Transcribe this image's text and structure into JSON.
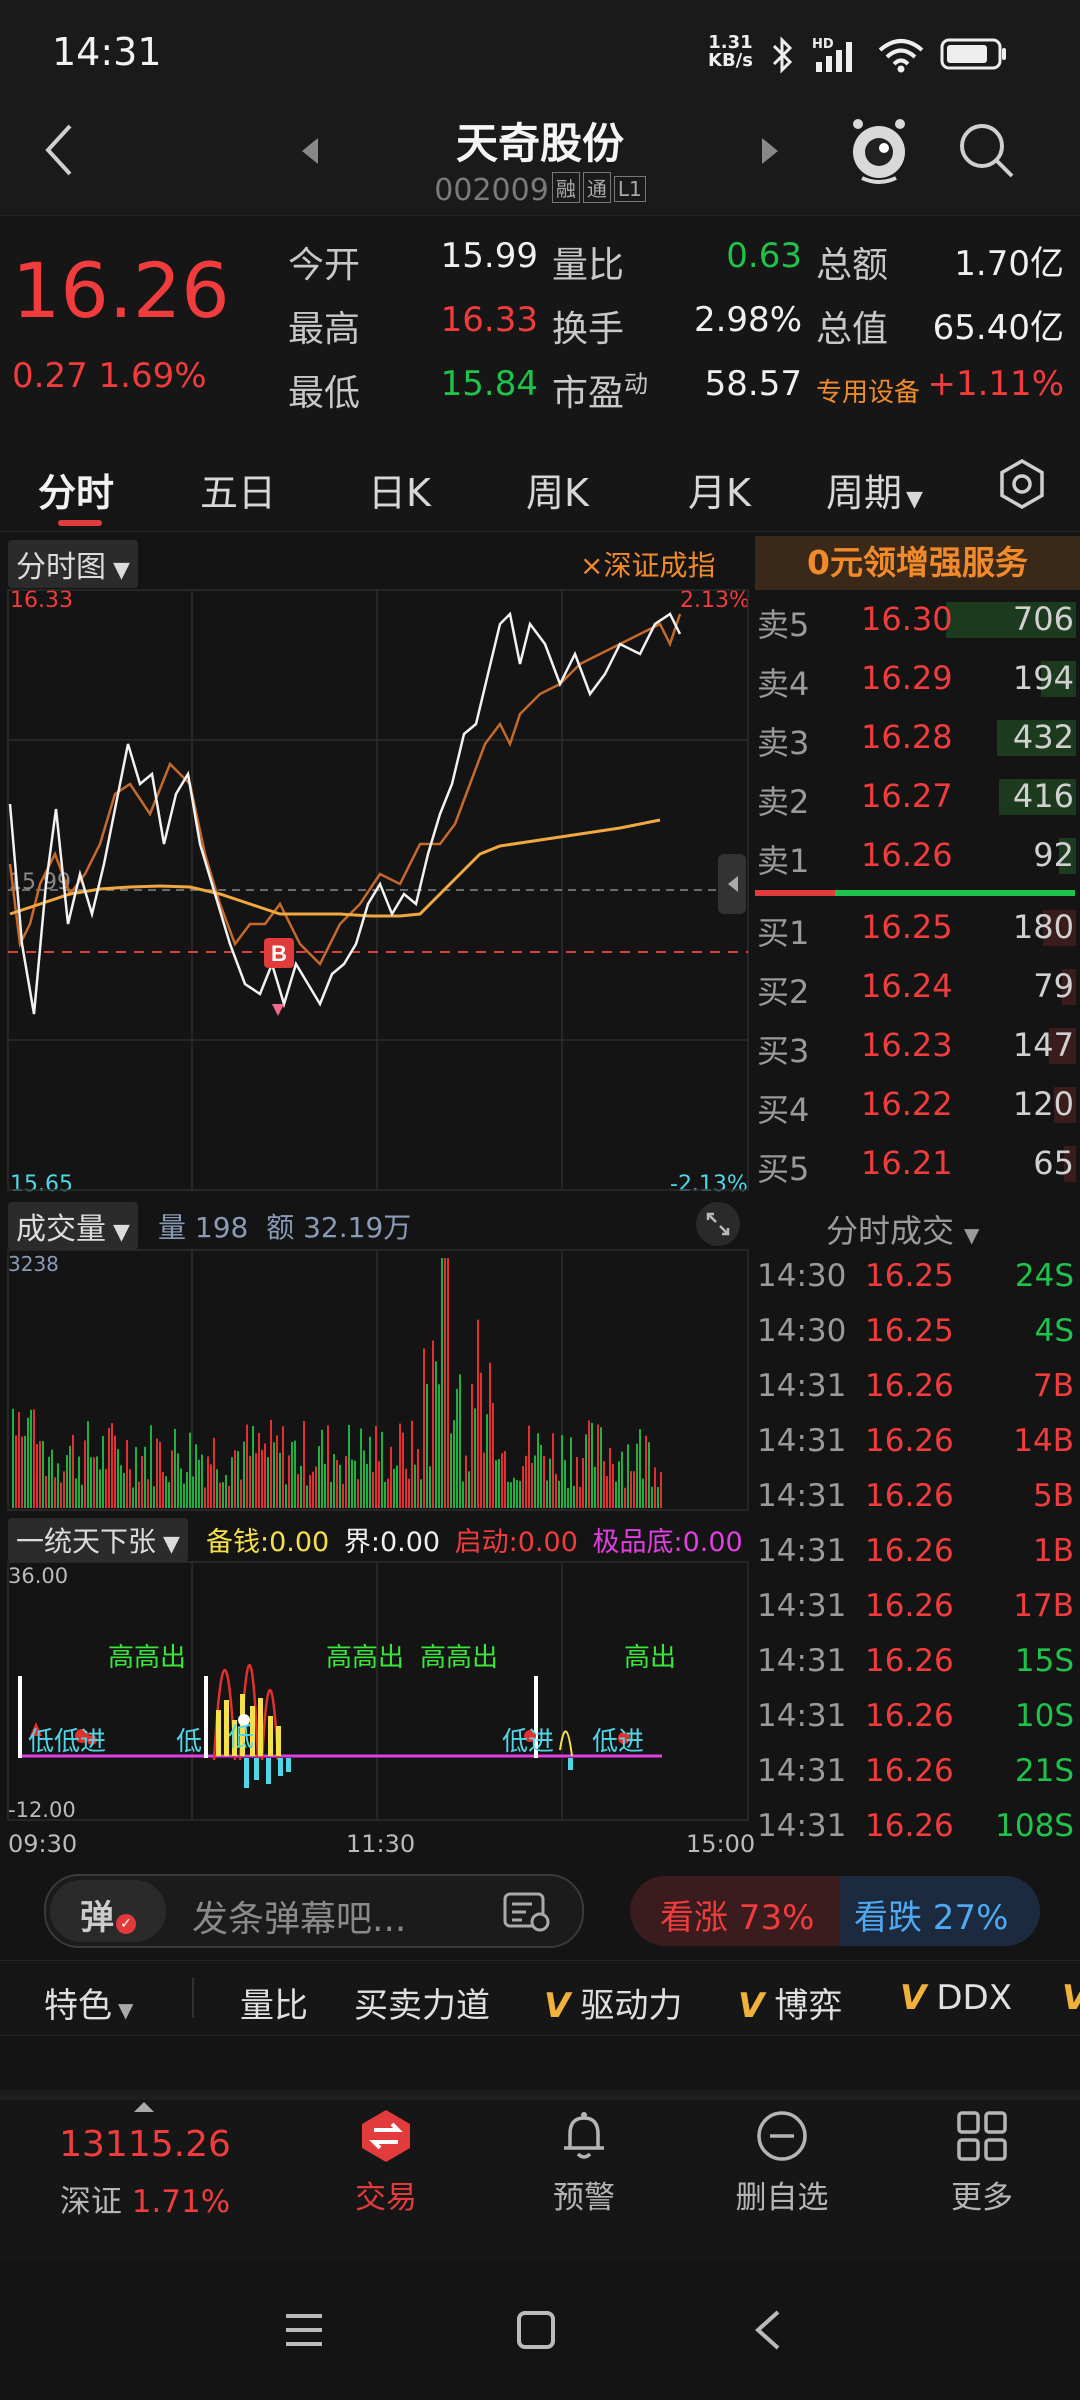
{
  "status_bar": {
    "time": "14:31",
    "net_speed_top": "1.31",
    "net_speed_bottom": "KB/s"
  },
  "header": {
    "stock_name": "天奇股份",
    "stock_code": "002009",
    "tags": [
      "融",
      "通",
      "L1"
    ]
  },
  "quote": {
    "price": "16.26",
    "change": "0.27",
    "change_pct": "1.69%",
    "rows": [
      [
        {
          "label": "今开",
          "value": "15.99"
        },
        {
          "label": "量比",
          "value": "0.63"
        },
        {
          "label": "总额",
          "value": "1.70亿"
        }
      ],
      [
        {
          "label": "最高",
          "value": "16.33"
        },
        {
          "label": "换手",
          "value": "2.98%"
        },
        {
          "label": "总值",
          "value": "65.40亿"
        }
      ],
      [
        {
          "label": "最低",
          "value": "15.84"
        },
        {
          "label": "市盈",
          "sup": "动",
          "value": "58.57"
        },
        {
          "label": "专用设备",
          "value": "+1.11%"
        }
      ]
    ]
  },
  "tabs": [
    "分时",
    "五日",
    "日K",
    "周K",
    "月K",
    "周期"
  ],
  "intraday": {
    "panel_label": "分时图",
    "compare_label": "×深证成指",
    "max_price": "16.33",
    "min_price": "15.65",
    "max_pct": "2.13%",
    "min_pct": "-2.13%",
    "ref_price": "15.99",
    "signal": "B",
    "promo": "0元领增强服务"
  },
  "volume": {
    "panel_label": "成交量",
    "vol_label": "量",
    "vol_value": "198",
    "amt_label": "额",
    "amt_value": "32.19万",
    "max": "3238"
  },
  "indicator": {
    "panel_label": "一统天下张",
    "items": [
      {
        "label": "备钱:",
        "value": "0.00",
        "color": "#f4e04a"
      },
      {
        "label": "界:",
        "value": "0.00",
        "color": "#f0f0f0"
      },
      {
        "label": "启动:",
        "value": "0.00",
        "color": "#f03c3c"
      },
      {
        "label": "极品底:",
        "value": "0.00",
        "color": "#e040e0"
      }
    ],
    "max": "36.00",
    "min": "-12.00",
    "texts_high": [
      "高出",
      "高高出",
      "高高出",
      "高高出",
      "高出"
    ],
    "texts_low": [
      "低低进",
      "低",
      "低",
      "低进",
      "低进"
    ]
  },
  "time_axis": [
    "09:30",
    "11:30",
    "15:00"
  ],
  "order_book": {
    "sell": [
      {
        "label": "卖5",
        "price": "16.30",
        "vol": "706",
        "bar": 1.0
      },
      {
        "label": "卖4",
        "price": "16.29",
        "vol": "194",
        "bar": 0.27
      },
      {
        "label": "卖3",
        "price": "16.28",
        "vol": "432",
        "bar": 0.61
      },
      {
        "label": "卖2",
        "price": "16.27",
        "vol": "416",
        "bar": 0.59
      },
      {
        "label": "卖1",
        "price": "16.26",
        "vol": "92",
        "bar": 0.13
      }
    ],
    "buy": [
      {
        "label": "买1",
        "price": "16.25",
        "vol": "180",
        "bar": 0.25
      },
      {
        "label": "买2",
        "price": "16.24",
        "vol": "79",
        "bar": 0.11
      },
      {
        "label": "买3",
        "price": "16.23",
        "vol": "147",
        "bar": 0.21
      },
      {
        "label": "买4",
        "price": "16.22",
        "vol": "120",
        "bar": 0.17
      },
      {
        "label": "买5",
        "price": "16.21",
        "vol": "65",
        "bar": 0.09
      }
    ]
  },
  "trades": {
    "title": "分时成交",
    "rows": [
      {
        "time": "14:30",
        "price": "16.25",
        "vol": "24S"
      },
      {
        "time": "14:30",
        "price": "16.25",
        "vol": "4S"
      },
      {
        "time": "14:31",
        "price": "16.26",
        "vol": "7B"
      },
      {
        "time": "14:31",
        "price": "16.26",
        "vol": "14B"
      },
      {
        "time": "14:31",
        "price": "16.26",
        "vol": "5B"
      },
      {
        "time": "14:31",
        "price": "16.26",
        "vol": "1B"
      },
      {
        "time": "14:31",
        "price": "16.26",
        "vol": "17B"
      },
      {
        "time": "14:31",
        "price": "16.26",
        "vol": "15S"
      },
      {
        "time": "14:31",
        "price": "16.26",
        "vol": "10S"
      },
      {
        "time": "14:31",
        "price": "16.26",
        "vol": "21S"
      },
      {
        "time": "14:31",
        "price": "16.26",
        "vol": "108S"
      }
    ]
  },
  "comment": {
    "toggle": "弹",
    "placeholder": "发条弹幕吧...",
    "bull": "看涨 73%",
    "bear": "看跌 27%",
    "bull_pct": 73
  },
  "features": {
    "first": "特色",
    "items": [
      "量比",
      "买卖力道",
      "驱动力",
      "博弈",
      "DDX"
    ],
    "v_items": [
      false,
      false,
      true,
      true,
      true
    ]
  },
  "bottom_bar": {
    "index_value": "13115.26",
    "index_name": "深证",
    "index_change": "1.71%",
    "trade": "交易",
    "alert": "预警",
    "remove": "删自选",
    "more": "更多"
  },
  "colors": {
    "up": "#f03c3c",
    "down": "#1fc24a",
    "accent": "#e23b3b",
    "promo": "#f08a2a"
  }
}
